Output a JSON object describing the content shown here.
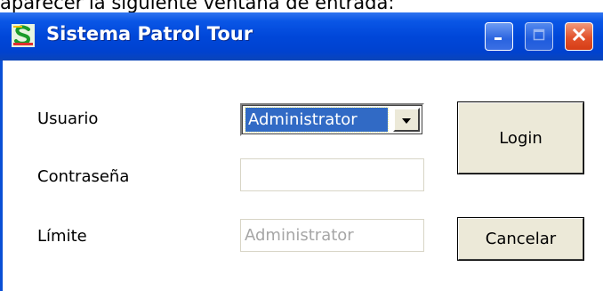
{
  "document": {
    "caption": "aparecer la siguiente ventana de entrada:"
  },
  "window": {
    "title": "Sistema Patrol Tour",
    "icon": "patrol-app-icon",
    "controls": {
      "minimize": "minimize-icon",
      "maximize": "maximize-icon",
      "close": "close-icon"
    }
  },
  "form": {
    "user_label": "Usuario",
    "user_value": "Administrator",
    "password_label": "Contraseña",
    "password_value": "",
    "limit_label": "Límite",
    "limit_value": "Administrator"
  },
  "buttons": {
    "login": "Login",
    "cancel": "Cancelar"
  },
  "colors": {
    "titlebar": "#0047d9",
    "selection": "#316ac5",
    "close_button": "#e2522b",
    "button_face": "#ece9d8"
  }
}
